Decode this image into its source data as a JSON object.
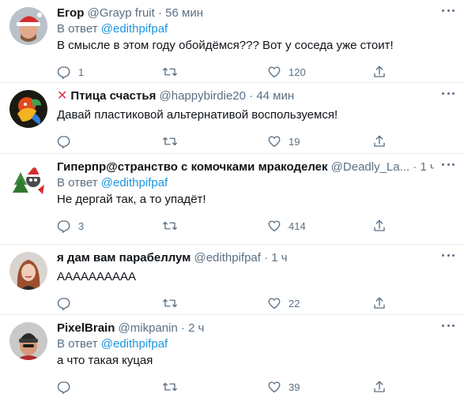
{
  "reply_prefix": "В ответ",
  "colors": {
    "text": "#0f1419",
    "muted": "#5b7083",
    "link": "#1b95e0",
    "divider": "#e6ecf0"
  },
  "tweets": [
    {
      "name": "Егор",
      "handle": "@Grayp fruit",
      "time": "56 мин",
      "reply_to": "@edithpifpaf",
      "text": "В смысле в этом году обойдёмся??? Вот у соседа уже стоит!",
      "replies": "1",
      "retweets": "",
      "likes": "120",
      "avatar_icon": "avatar-man-santa-hat"
    },
    {
      "name": "Птица счастья",
      "name_prefix_icon": "cross-mark-icon",
      "handle": "@happybirdie20",
      "time": "44 мин",
      "reply_to": "",
      "text": "Давай пластиковой альтернативой воспользуемся!",
      "replies": "",
      "retweets": "",
      "likes": "19",
      "avatar_icon": "avatar-colorful-bird"
    },
    {
      "name": "Гиперпр@странство с комочками мракоделек",
      "handle": "@Deadly_La...",
      "time": "1 ч",
      "reply_to": "@edithpifpaf",
      "text": "Не дергай так, а то упадёт!",
      "replies": "3",
      "retweets": "",
      "likes": "414",
      "avatar_icon": "avatar-christmas-character"
    },
    {
      "name": "я дам вам парабеллум",
      "handle": "@edithpifpaf",
      "time": "1 ч",
      "reply_to": "",
      "text": "АААААААААА",
      "replies": "",
      "retweets": "",
      "likes": "22",
      "avatar_icon": "avatar-woman-portrait"
    },
    {
      "name": "PixelBrain",
      "handle": "@mikpanin",
      "time": "2 ч",
      "reply_to": "@edithpifpaf",
      "text": "а что такая куцая",
      "replies": "",
      "retweets": "",
      "likes": "39",
      "avatar_icon": "avatar-man-beanie"
    }
  ]
}
